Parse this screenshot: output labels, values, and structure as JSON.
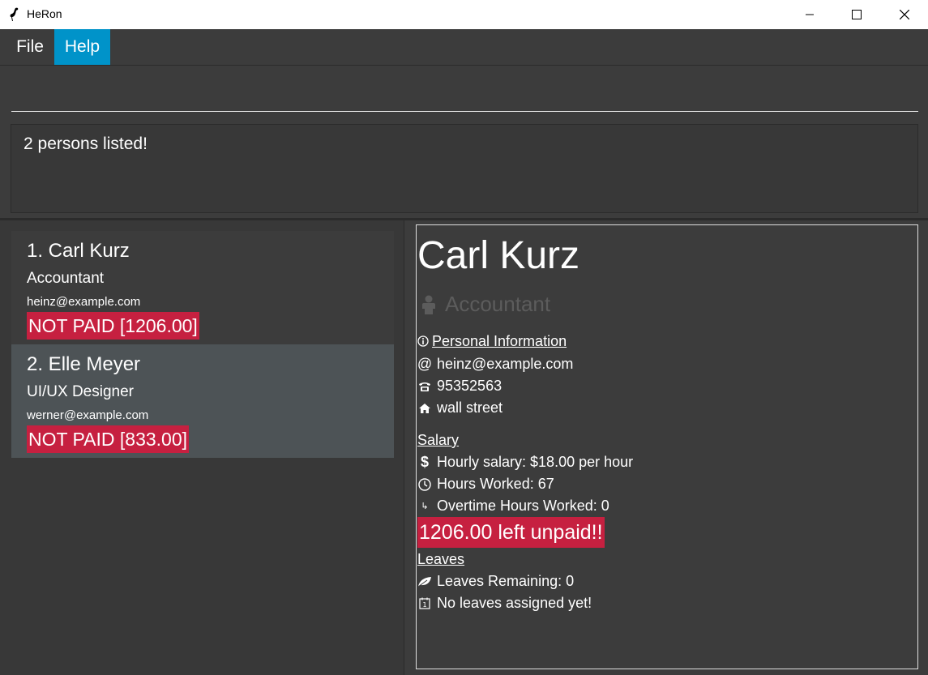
{
  "window": {
    "title": "HeRon"
  },
  "menu": {
    "file_label": "File",
    "help_label": "Help"
  },
  "command": {
    "value": ""
  },
  "result": {
    "message": "2 persons listed!"
  },
  "persons": [
    {
      "index_name": "1.  Carl Kurz",
      "role": "Accountant",
      "email": "heinz@example.com",
      "pay_status": "NOT PAID [1206.00]"
    },
    {
      "index_name": "2.  Elle Meyer",
      "role": "UI/UX Designer",
      "email": "werner@example.com",
      "pay_status": "NOT PAID [833.00]"
    }
  ],
  "detail": {
    "name": "Carl Kurz",
    "role": "Accountant",
    "personal_heading": "Personal Information",
    "email": "heinz@example.com",
    "phone": "95352563",
    "address": "wall street",
    "salary_heading": "Salary",
    "hourly_salary": "Hourly salary: $18.00 per hour",
    "hours_worked": "Hours Worked: 67",
    "overtime_hours": "Overtime Hours Worked: 0",
    "unpaid": "1206.00 left unpaid!!",
    "leaves_heading": "Leaves",
    "leaves_remaining": "Leaves Remaining: 0",
    "leaves_assigned": "No leaves assigned yet!"
  },
  "colors": {
    "accent": "#0093c9",
    "unpaid": "#c62040",
    "background": "#3c3c3c",
    "selected_card": "#4d5356"
  }
}
